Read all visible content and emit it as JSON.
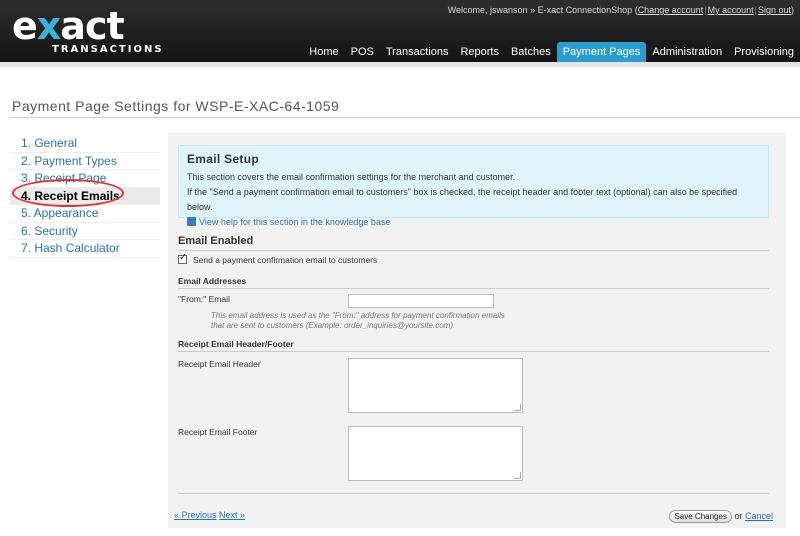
{
  "header": {
    "logo_mark_a": "e",
    "logo_mark_x": "x",
    "logo_mark_b": "act",
    "logo_sub": "TRANSACTIONS",
    "welcome": "Welcome, jswanson",
    "arrow": "»",
    "shop": "E-xact ConnectionShop",
    "change_account": "Change account",
    "my_account": "My account",
    "sign_out": "Sign out"
  },
  "nav": [
    {
      "label": "Home"
    },
    {
      "label": "POS"
    },
    {
      "label": "Transactions"
    },
    {
      "label": "Reports"
    },
    {
      "label": "Batches"
    },
    {
      "label": "Payment Pages",
      "active": true
    },
    {
      "label": "Administration"
    },
    {
      "label": "Provisioning"
    }
  ],
  "page_title": "Payment Page Settings for WSP-E-XAC-64-1059",
  "sidebar": [
    {
      "label": "1. General"
    },
    {
      "label": "2. Payment Types"
    },
    {
      "label": "3. Receipt Page"
    },
    {
      "label": "4. Receipt Emails",
      "active": true
    },
    {
      "label": "5. Appearance"
    },
    {
      "label": "6. Security"
    },
    {
      "label": "7. Hash Calculator"
    }
  ],
  "info": {
    "title": "Email Setup",
    "line1": "This section covers the email confirmation settings for the merchant and customer.",
    "line2": "If the \"Send a payment confirmation email to customers\" box is checked, the receipt header and footer text (optional) can also be specified below.",
    "help_link": "View help for this section in the knowledge base"
  },
  "form": {
    "email_enabled_heading": "Email Enabled",
    "send_checkbox_label": "Send a payment confirmation email to customers",
    "send_checked": true,
    "addresses_heading": "Email Addresses",
    "from_label": "\"From:\" Email",
    "from_value": "",
    "from_note": "This email address is used as the \"From:\" address for payment confirmation emails that are sent to customers (Example: order_inquiries@yoursite.com)",
    "header_footer_heading": "Receipt Email Header/Footer",
    "header_label": "Receipt Email Header",
    "footer_label": "Receipt Email Footer"
  },
  "footer": {
    "previous": "« Previous",
    "next": "Next »",
    "save": "Save Changes",
    "or": "or",
    "cancel": "Cancel"
  },
  "colors": {
    "header_bg": "#1a1a1a",
    "nav_active": "#2a9ccd",
    "logo_accent": "#3bb0d8",
    "info_bg": "#dff4fa",
    "link": "#2b6fb0",
    "highlight_ring": "#dd3333"
  }
}
